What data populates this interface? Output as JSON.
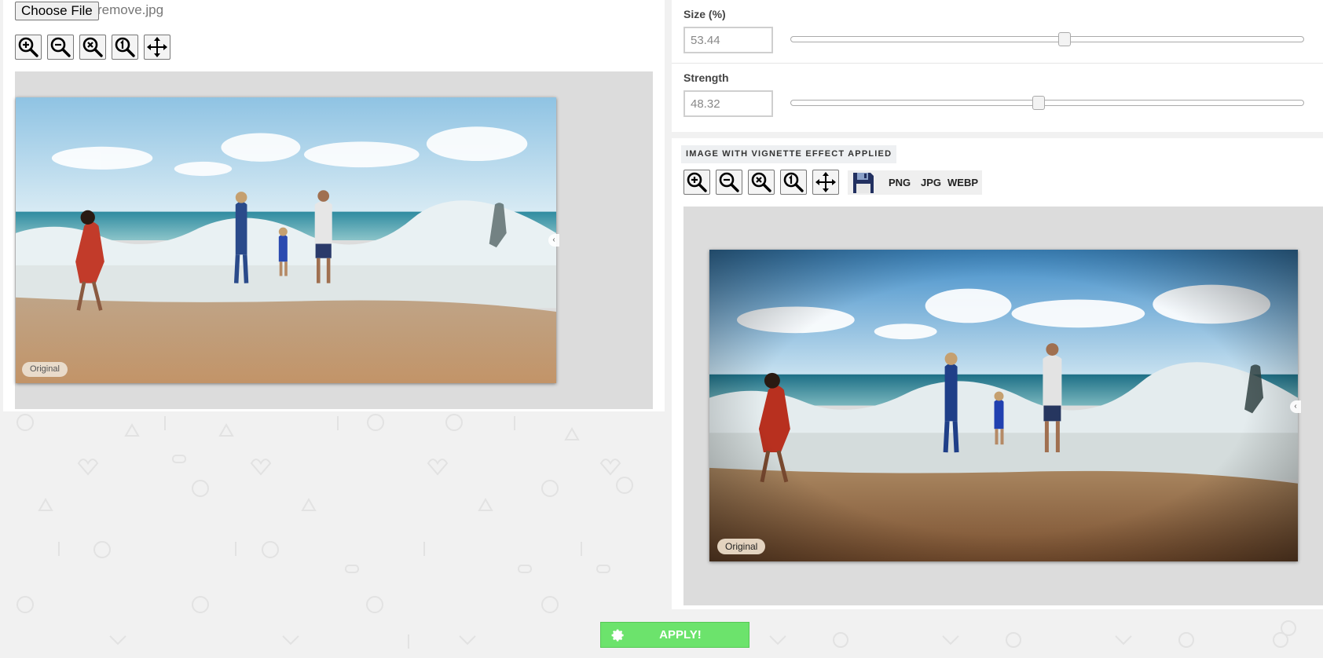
{
  "file_input": {
    "button_label": "Choose File",
    "file_name": "remove.jpg"
  },
  "left_toolbar": {
    "icons": [
      "zoom-in-icon",
      "zoom-out-icon",
      "zoom-reset-icon",
      "zoom-actual-size-icon",
      "move-icon"
    ]
  },
  "original_preview": {
    "badge": "Original"
  },
  "settings": {
    "size": {
      "label": "Size (%)",
      "value": "53.44",
      "slider_fraction": 0.534
    },
    "strength": {
      "label": "Strength",
      "value": "48.32",
      "slider_fraction": 0.483
    }
  },
  "result": {
    "title": "IMAGE WITH VIGNETTE EFFECT APPLIED",
    "toolbar_icons": [
      "zoom-in-icon",
      "zoom-out-icon",
      "zoom-reset-icon",
      "zoom-actual-size-icon",
      "move-icon"
    ],
    "save_icon": "floppy-disk-icon",
    "formats": [
      "PNG",
      "JPG",
      "WEBP"
    ],
    "badge": "Original"
  },
  "apply": {
    "label": "APPLY!",
    "icon": "gear-icon",
    "color": "#6ce36c"
  }
}
